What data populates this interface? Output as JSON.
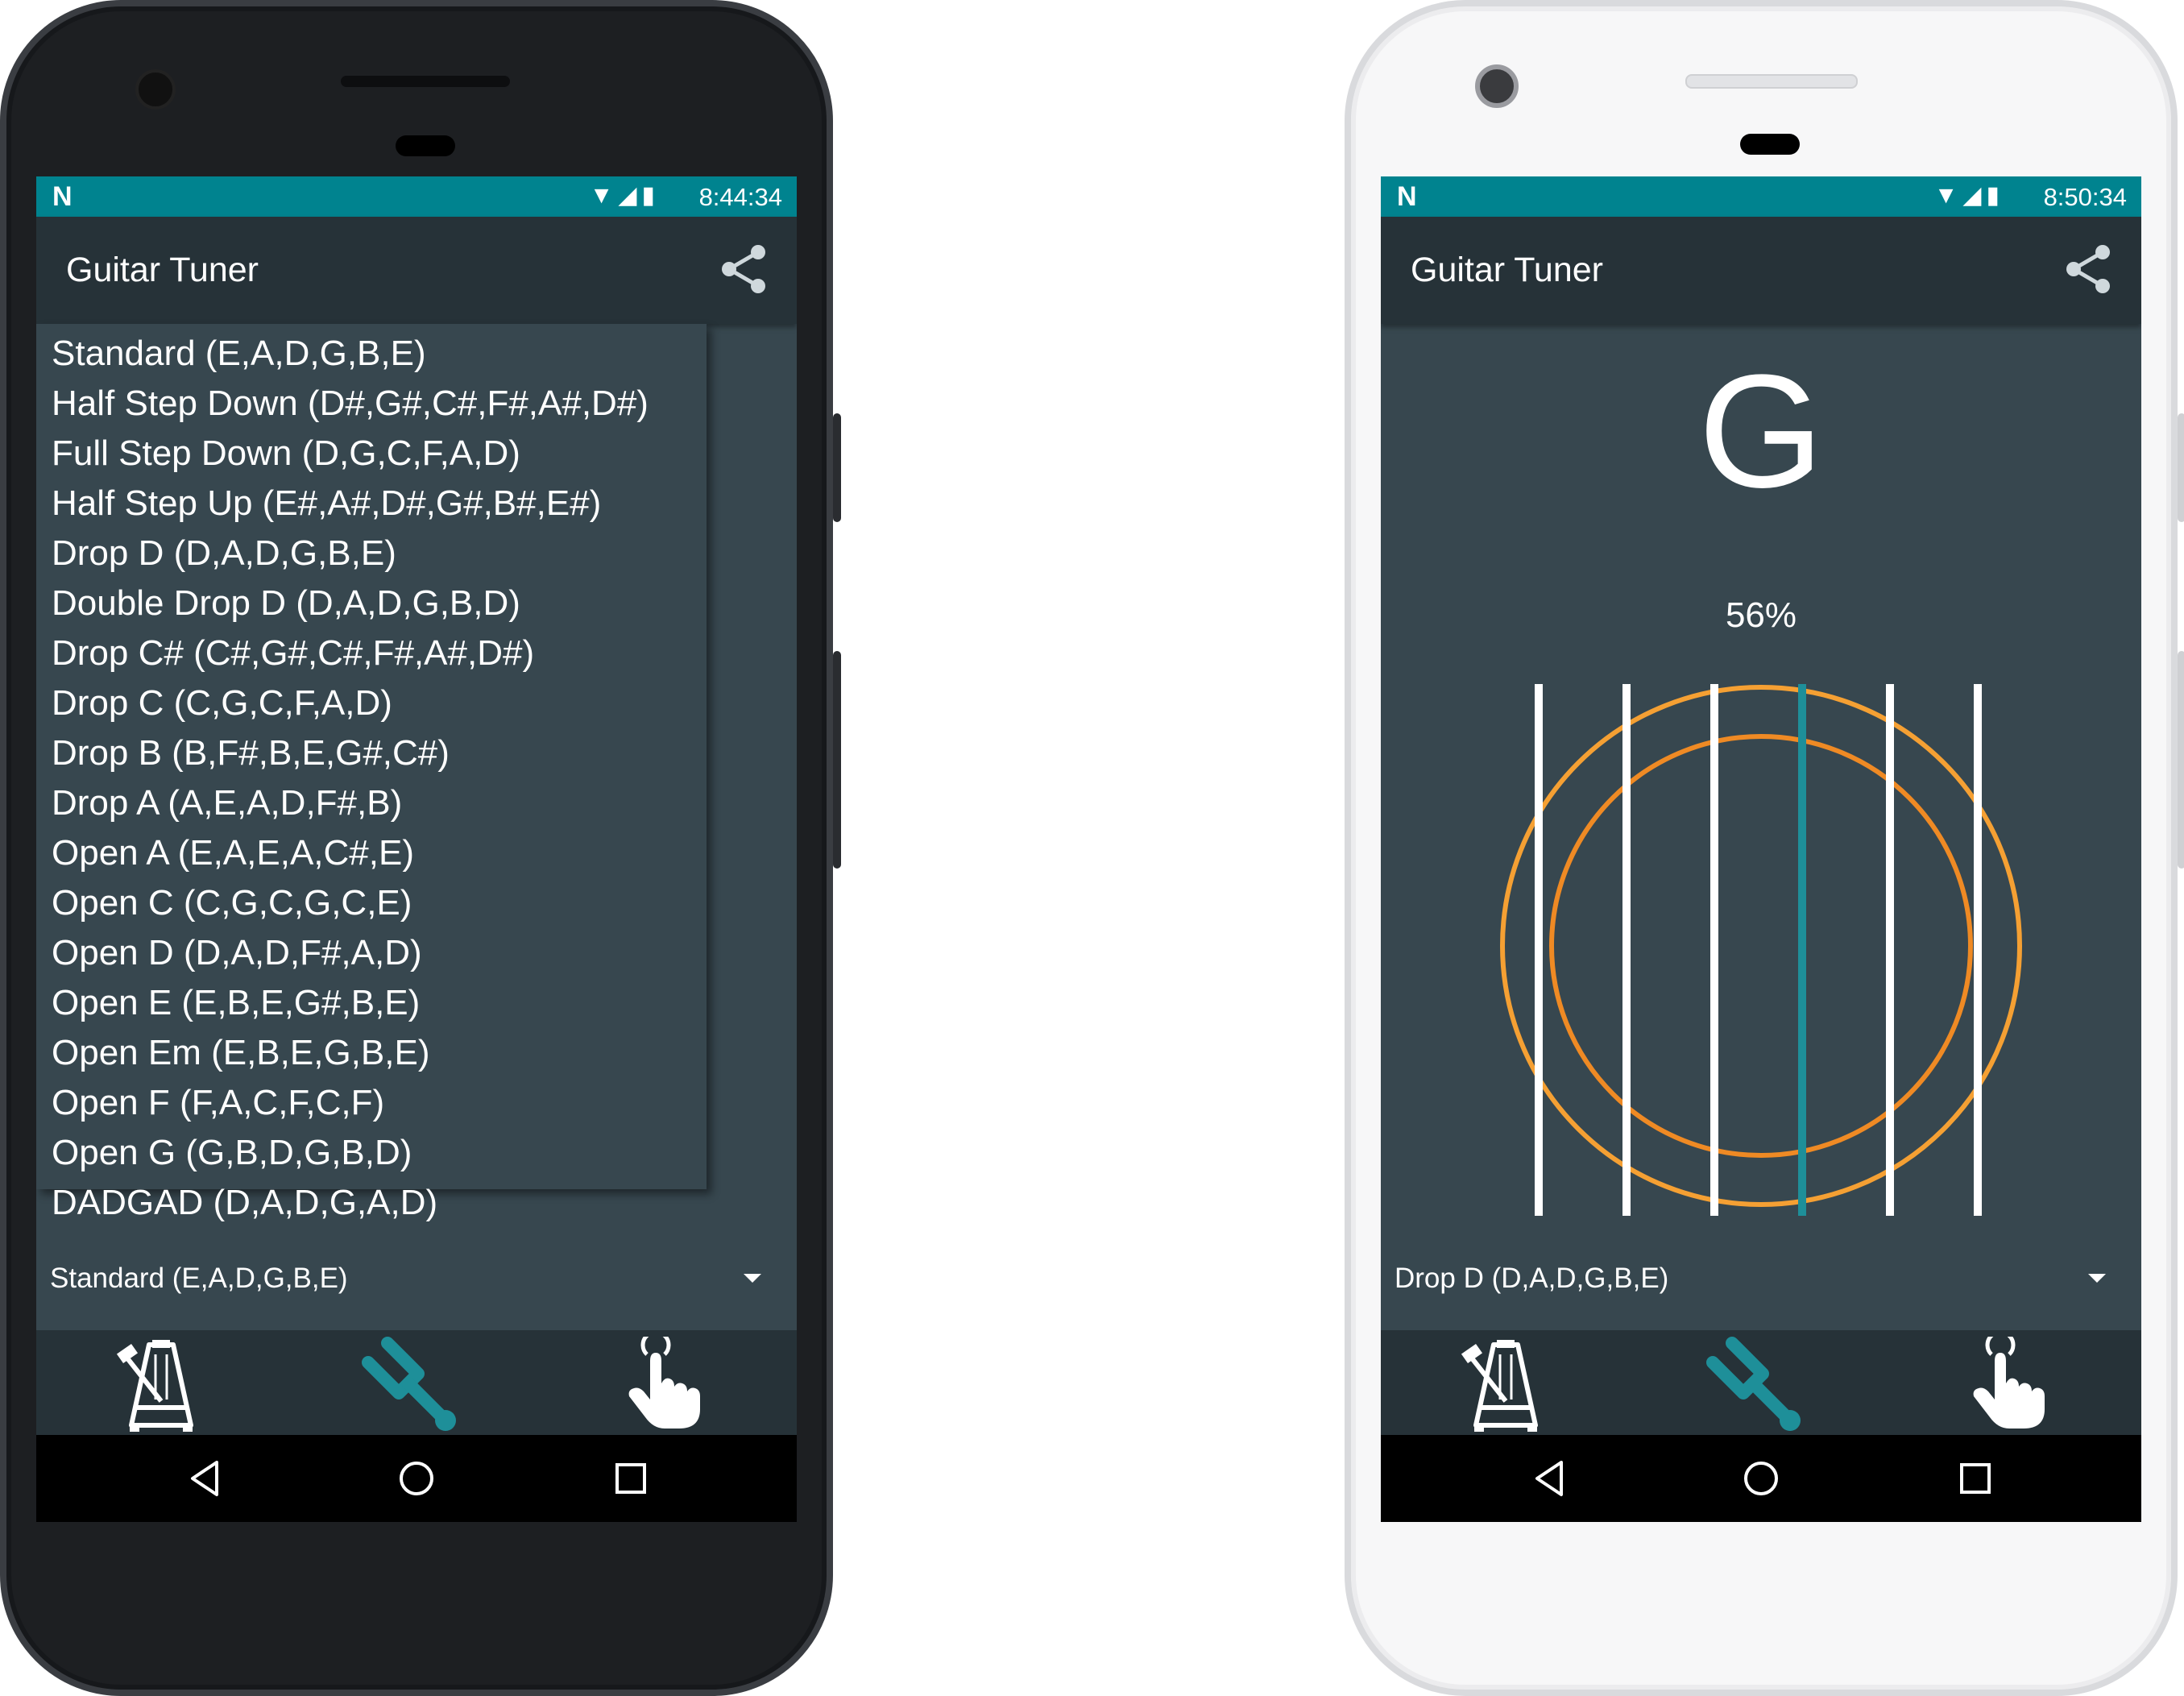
{
  "left_phone": {
    "status": {
      "time": "8:44:34",
      "app_icon": "n-icon",
      "wifi": "wifi-icon",
      "signal": "signal-icon",
      "battery": "battery-icon"
    },
    "appbar": {
      "title": "Guitar Tuner",
      "share_icon": "share-icon"
    },
    "tuning_options": [
      "Standard (E,A,D,G,B,E)",
      "Half Step Down (D#,G#,C#,F#,A#,D#)",
      "Full Step Down (D,G,C,F,A,D)",
      "Half Step Up (E#,A#,D#,G#,B#,E#)",
      "Drop D (D,A,D,G,B,E)",
      "Double Drop D (D,A,D,G,B,D)",
      "Drop C# (C#,G#,C#,F#,A#,D#)",
      "Drop C (C,G,C,F,A,D)",
      "Drop B (B,F#,B,E,G#,C#)",
      "Drop A (A,E,A,D,F#,B)",
      "Open A (E,A,E,A,C#,E)",
      "Open C (C,G,C,G,C,E)",
      "Open D (D,A,D,F#,A,D)",
      "Open E (E,B,E,G#,B,E)",
      "Open Em (E,B,E,G,B,E)",
      "Open F (F,A,C,F,C,F)",
      "Open G (G,B,D,G,B,D)",
      "DADGAD (D,A,D,G,A,D)"
    ],
    "selected_tuning": "Standard (E,A,D,G,B,E)"
  },
  "right_phone": {
    "status": {
      "time": "8:50:34",
      "app_icon": "n-icon",
      "wifi": "wifi-icon",
      "signal": "signal-icon",
      "battery": "battery-icon"
    },
    "appbar": {
      "title": "Guitar Tuner",
      "share_icon": "share-icon"
    },
    "tuner": {
      "note": "G",
      "accuracy": "56%",
      "active_string_index": 3,
      "string_count": 6
    },
    "selected_tuning": "Drop D (D,A,D,G,B,E)"
  },
  "bottom_tabs": [
    {
      "name": "metronome",
      "icon": "metronome-icon",
      "active": false
    },
    {
      "name": "tuner",
      "icon": "tuning-fork-icon",
      "active": true
    },
    {
      "name": "tap",
      "icon": "tap-hand-icon",
      "active": false
    }
  ],
  "nav_buttons": [
    "back-icon",
    "home-icon",
    "recents-icon"
  ],
  "colors": {
    "status_bar": "#00838f",
    "app_bar": "#263238",
    "screen_bg": "#37474f",
    "accent_teal": "#1e8f99",
    "ring_outer": "#f5a033",
    "ring_inner": "#ef8a24"
  }
}
